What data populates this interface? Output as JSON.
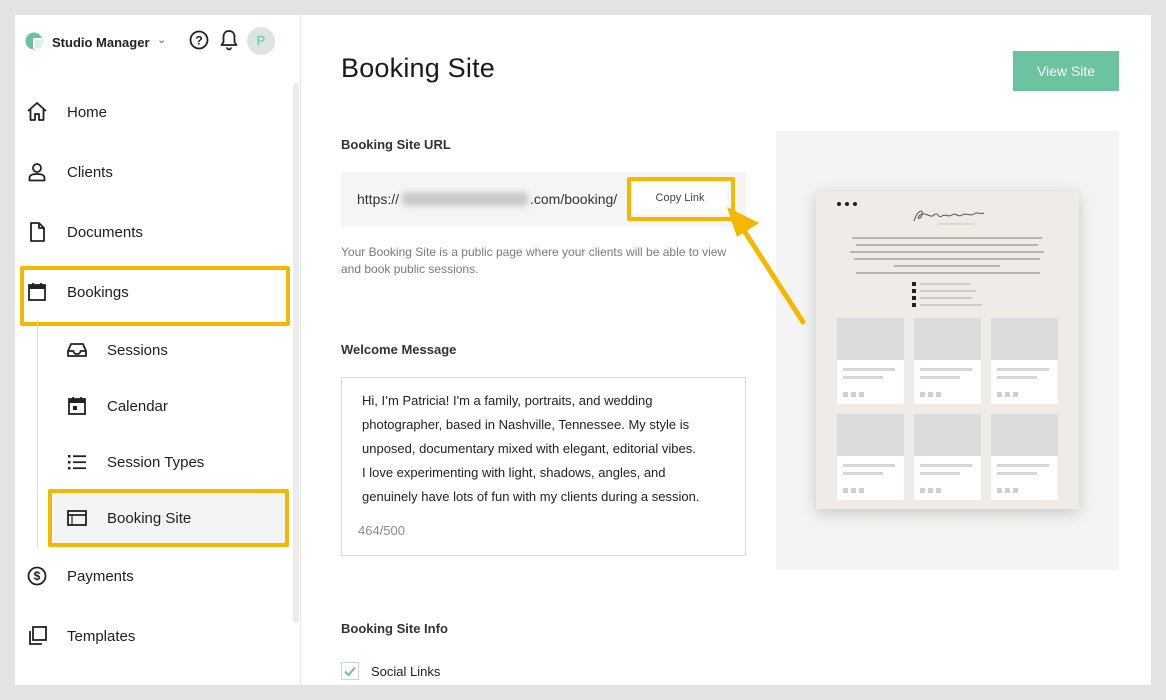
{
  "app": {
    "brand_name": "Studio Manager",
    "avatar_initial": "P",
    "accent_color": "#6cc39f",
    "highlight_color": "#f5b800"
  },
  "sidebar": {
    "items": [
      {
        "label": "Home",
        "icon": "home-icon"
      },
      {
        "label": "Clients",
        "icon": "user-icon"
      },
      {
        "label": "Documents",
        "icon": "document-icon"
      },
      {
        "label": "Bookings",
        "icon": "calendar-icon"
      },
      {
        "label": "Payments",
        "icon": "dollar-circle-icon"
      },
      {
        "label": "Templates",
        "icon": "templates-icon"
      }
    ],
    "sub_items": [
      {
        "label": "Sessions",
        "icon": "inbox-icon"
      },
      {
        "label": "Calendar",
        "icon": "calendar-day-icon"
      },
      {
        "label": "Session Types",
        "icon": "list-icon"
      },
      {
        "label": "Booking Site",
        "icon": "browser-icon"
      }
    ]
  },
  "main": {
    "title": "Booking Site",
    "view_site_label": "View Site",
    "url_section_label": "Booking Site URL",
    "url_prefix": "https://",
    "url_suffix": ".com/booking/",
    "copy_link_label": "Copy Link",
    "helper_text": "Your Booking Site is a public page where your clients will be able to view and book public sessions.",
    "welcome_label": "Welcome Message",
    "welcome_lines": [
      "Hi, I’m Patricia! I'm a family, portraits, and wedding",
      "photographer, based in Nashville, Tennessee. My style is",
      "unposed, documentary mixed with elegant, editorial vibes.",
      "I love experimenting with light, shadows, angles, and",
      "genuinely have lots of fun with my clients during a session."
    ],
    "char_count": "464/500",
    "info_label": "Booking Site Info",
    "social_links_label": "Social Links",
    "social_links_checked": true
  },
  "preview": {
    "signature": "Patricia Johnson"
  }
}
